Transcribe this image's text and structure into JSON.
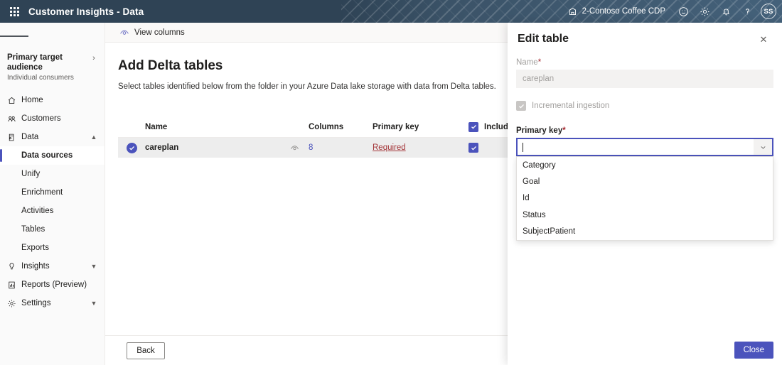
{
  "header": {
    "waffle_label": "app-launcher",
    "app_title": "Customer Insights - Data",
    "environment": "2-Contoso Coffee CDP",
    "avatar_initials": "SS",
    "icons": {
      "org": "org-icon",
      "feedback": "smiley-feedback-icon",
      "settings": "gear-icon",
      "notifications": "bell-icon",
      "help": "question-mark-icon"
    },
    "colors": {
      "bg": "#2f4355",
      "text": "#ffffff"
    }
  },
  "sidebar": {
    "audience": {
      "title": "Primary target audience",
      "subtitle": "Individual consumers"
    },
    "items": [
      {
        "label": "Home",
        "icon": "home-icon",
        "level": "top",
        "expandable": false,
        "selected": false
      },
      {
        "label": "Customers",
        "icon": "customers-icon",
        "level": "top",
        "expandable": false,
        "selected": false
      },
      {
        "label": "Data",
        "icon": "data-icon",
        "level": "top",
        "expandable": true,
        "expanded": true,
        "selected": false
      },
      {
        "label": "Data sources",
        "icon": "",
        "level": "sub",
        "expandable": false,
        "selected": true
      },
      {
        "label": "Unify",
        "icon": "",
        "level": "sub",
        "expandable": false,
        "selected": false
      },
      {
        "label": "Enrichment",
        "icon": "",
        "level": "sub",
        "expandable": false,
        "selected": false
      },
      {
        "label": "Activities",
        "icon": "",
        "level": "sub",
        "expandable": false,
        "selected": false
      },
      {
        "label": "Tables",
        "icon": "",
        "level": "sub",
        "expandable": false,
        "selected": false
      },
      {
        "label": "Exports",
        "icon": "",
        "level": "sub",
        "expandable": false,
        "selected": false
      },
      {
        "label": "Insights",
        "icon": "lightbulb-icon",
        "level": "top",
        "expandable": true,
        "expanded": false,
        "selected": false
      },
      {
        "label": "Reports (Preview)",
        "icon": "report-icon",
        "level": "top",
        "expandable": false,
        "selected": false
      },
      {
        "label": "Settings",
        "icon": "gear-icon",
        "level": "top",
        "expandable": true,
        "expanded": false,
        "selected": false
      }
    ]
  },
  "main": {
    "command_bar": {
      "view_columns_label": "View columns",
      "view_columns_icon": "eye-icon"
    },
    "page_title": "Add Delta tables",
    "page_subtitle": "Select tables identified below from the folder in your Azure Data lake storage with data from Delta tables.",
    "table": {
      "columns": [
        "Name",
        "Columns",
        "Primary key",
        "Include"
      ],
      "include_header_checked": true,
      "include_info_icon": "info-icon",
      "rows": [
        {
          "selected": true,
          "name": "careplan",
          "preview_icon": "eye-icon",
          "columns": "8",
          "primary_key": "Required",
          "primary_key_state": "required",
          "include": true
        }
      ]
    },
    "footer": {
      "back_label": "Back"
    }
  },
  "panel": {
    "title": "Edit table",
    "close_icon": "close-icon",
    "name_label": "Name",
    "name_required_marker": "*",
    "name_value": "careplan",
    "name_disabled": true,
    "incremental_label": "Incremental ingestion",
    "incremental_checked": true,
    "incremental_disabled": true,
    "primary_key_label": "Primary key",
    "primary_key_required_marker": "*",
    "primary_key_value": "",
    "dropdown_open": true,
    "dropdown_options": [
      "Category",
      "Goal",
      "Id",
      "Status",
      "SubjectPatient"
    ],
    "chevron_icon": "chevron-down-icon",
    "close_button_label": "Close"
  },
  "colors": {
    "accent": "#4b53bc",
    "header_bg": "#2f4355",
    "required_red": "#a4373a",
    "row_selected_bg": "#ededed"
  }
}
